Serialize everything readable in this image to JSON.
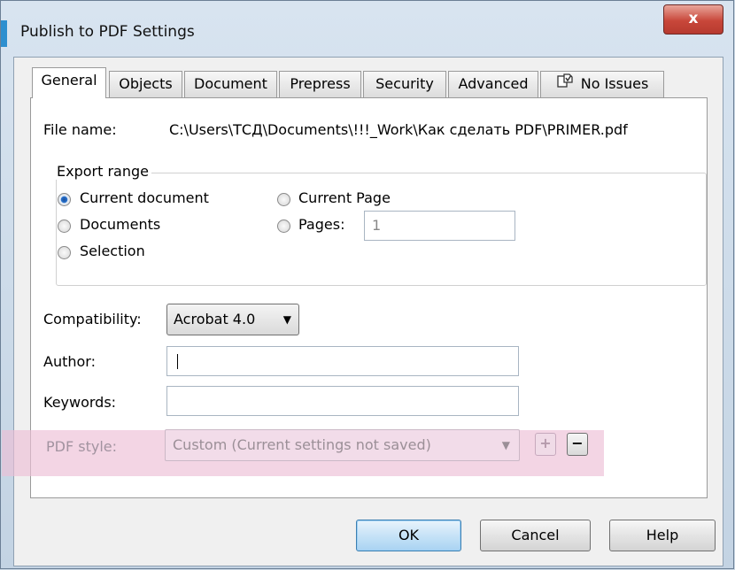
{
  "window": {
    "title": "Publish to PDF Settings",
    "close_label": "x"
  },
  "tabs": [
    {
      "label": "General",
      "active": true
    },
    {
      "label": "Objects"
    },
    {
      "label": "Document"
    },
    {
      "label": "Prepress"
    },
    {
      "label": "Security"
    },
    {
      "label": "Advanced"
    },
    {
      "label": "No Issues",
      "icon": "issues-icon"
    }
  ],
  "general": {
    "file_name_label": "File name:",
    "file_name_value": "C:\\Users\\ТСД\\Documents\\!!!_Work\\Как сделать PDF\\PRIMER.pdf",
    "export_range": {
      "legend": "Export range",
      "options": [
        "Current document",
        "Documents",
        "Selection",
        "Current Page",
        "Pages:"
      ],
      "selected": "Current document",
      "pages_value": "1"
    },
    "compatibility_label": "Compatibility:",
    "compatibility_value": "Acrobat 4.0",
    "author_label": "Author:",
    "author_value": "",
    "keywords_label": "Keywords:",
    "keywords_value": "",
    "pdf_style_label": "PDF style:",
    "pdf_style_value": "Custom (Current settings not saved)",
    "add_style_label": "+",
    "remove_style_label": "−"
  },
  "buttons": {
    "ok": "OK",
    "cancel": "Cancel",
    "help": "Help"
  },
  "colors": {
    "highlight": "#ecbed6",
    "accent": "#2d8fcf",
    "close": "#c8473a"
  }
}
